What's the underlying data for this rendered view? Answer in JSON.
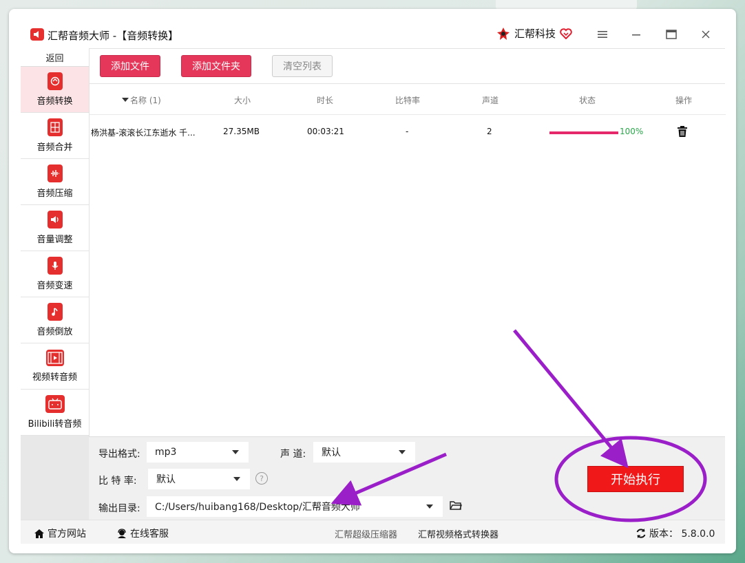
{
  "app": {
    "title": "汇帮音频大师  -【音频转换】",
    "brand": "汇帮科技"
  },
  "sidebar": {
    "back": "返回",
    "items": [
      {
        "label": "音频转换",
        "icon": "convert-icon"
      },
      {
        "label": "音频合并",
        "icon": "merge-icon"
      },
      {
        "label": "音频压缩",
        "icon": "compress-icon"
      },
      {
        "label": "音量调整",
        "icon": "volume-icon"
      },
      {
        "label": "音频变速",
        "icon": "microphone-icon"
      },
      {
        "label": "音频倒放",
        "icon": "music-note-icon"
      },
      {
        "label": "视频转音频",
        "icon": "film-icon"
      },
      {
        "label": "Bilibili转音频",
        "icon": "bilibili-icon"
      }
    ]
  },
  "toolbar": {
    "add_file": "添加文件",
    "add_folder": "添加文件夹",
    "clear_list": "清空列表"
  },
  "table": {
    "columns": [
      "名称 (1)",
      "大小",
      "时长",
      "比特率",
      "声道",
      "状态",
      "操作"
    ],
    "rows": [
      {
        "name": "杨洪基-滚滚长江东逝水  千...",
        "size": "27.35MB",
        "duration": "00:03:21",
        "bitrate": "-",
        "channels": "2",
        "progress": 1.0,
        "progress_text": "100%"
      }
    ]
  },
  "settings": {
    "format_label": "导出格式:",
    "format_value": "mp3",
    "channel_label": "声 道:",
    "channel_value": "默认",
    "bitrate_label": "比 特 率:",
    "bitrate_value": "默认",
    "output_label": "输出目录:",
    "output_value": "C:/Users/huibang168/Desktop/汇帮音频大师"
  },
  "start_button": "开始执行",
  "statusbar": {
    "website": "官方网站",
    "support": "在线客服",
    "link1": "汇帮超级压缩器",
    "link2": "汇帮视频格式转换器",
    "version": "版本：  5.8.0.0"
  },
  "colors": {
    "accent": "#e5375a",
    "start": "#f01818",
    "annotation": "#9b1fc9",
    "progress": "#e5286a"
  }
}
